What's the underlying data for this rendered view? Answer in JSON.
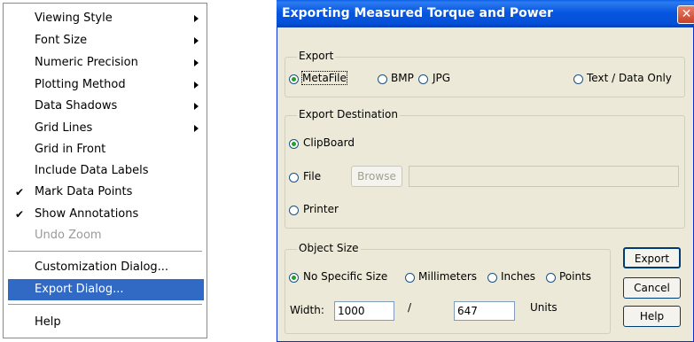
{
  "menu": {
    "items": [
      {
        "label": "Viewing Style",
        "submenu": true,
        "checked": false,
        "disabled": false
      },
      {
        "label": "Font Size",
        "submenu": true,
        "checked": false,
        "disabled": false
      },
      {
        "label": "Numeric Precision",
        "submenu": true,
        "checked": false,
        "disabled": false
      },
      {
        "label": "Plotting Method",
        "submenu": true,
        "checked": false,
        "disabled": false
      },
      {
        "label": "Data Shadows",
        "submenu": true,
        "checked": false,
        "disabled": false
      },
      {
        "label": "Grid Lines",
        "submenu": true,
        "checked": false,
        "disabled": false
      },
      {
        "label": "Grid in Front",
        "submenu": false,
        "checked": false,
        "disabled": false
      },
      {
        "label": "Include Data Labels",
        "submenu": false,
        "checked": false,
        "disabled": false
      },
      {
        "label": "Mark Data Points",
        "submenu": false,
        "checked": true,
        "disabled": false
      },
      {
        "label": "Show Annotations",
        "submenu": false,
        "checked": true,
        "disabled": false
      },
      {
        "label": "Undo Zoom",
        "submenu": false,
        "checked": false,
        "disabled": true
      },
      {
        "label": "Customization Dialog...",
        "submenu": false,
        "checked": false,
        "disabled": false
      },
      {
        "label": "Export Dialog...",
        "submenu": false,
        "checked": false,
        "disabled": false,
        "selected": true
      },
      {
        "label": "Help",
        "submenu": false,
        "checked": false,
        "disabled": false
      }
    ],
    "check_glyph": "✔"
  },
  "dialog": {
    "title": "Exporting Measured Torque and Power",
    "close_glyph": "✕",
    "export_group": {
      "title": "Export",
      "options": [
        {
          "label": "MetaFile",
          "selected": true
        },
        {
          "label": "BMP",
          "selected": false
        },
        {
          "label": "JPG",
          "selected": false
        },
        {
          "label": "Text / Data Only",
          "selected": false
        }
      ]
    },
    "destination_group": {
      "title": "Export Destination",
      "clipboard_label": "ClipBoard",
      "clipboard_selected": true,
      "file_label": "File",
      "file_selected": false,
      "browse_label": "Browse",
      "file_path": "",
      "printer_label": "Printer",
      "printer_selected": false
    },
    "size_group": {
      "title": "Object Size",
      "options": [
        {
          "label": "No Specific Size",
          "selected": true
        },
        {
          "label": "Millimeters",
          "selected": false
        },
        {
          "label": "Inches",
          "selected": false
        },
        {
          "label": "Points",
          "selected": false
        }
      ],
      "width_label": "Width:",
      "width_value": "1000",
      "separator": "/",
      "height_value": "647",
      "units_label": "Units"
    },
    "buttons": {
      "export": "Export",
      "cancel": "Cancel",
      "help": "Help"
    }
  }
}
